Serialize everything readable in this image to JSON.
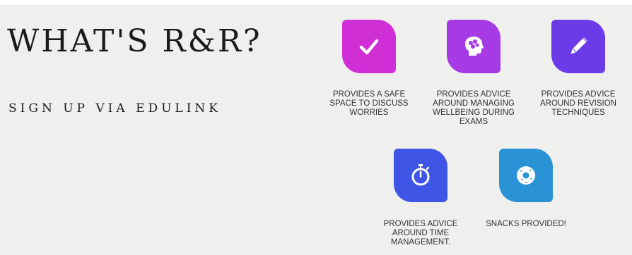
{
  "title": "WHAT'S R&R?",
  "subtitle": "SIGN UP VIA EDULINK",
  "features": [
    {
      "icon": "checkmark-icon",
      "color": "#d12fd6",
      "caption": "PROVIDES A SAFE SPACE TO DISCUSS WORRIES"
    },
    {
      "icon": "brain-icon",
      "color": "#a63be6",
      "caption": "PROVIDES ADVICE AROUND MANAGING WELLBEING DURING EXAMS"
    },
    {
      "icon": "pencil-icon",
      "color": "#6a3be6",
      "caption": "PROVIDES ADVICE AROUND REVISION TECHNIQUES"
    },
    {
      "icon": "stopwatch-icon",
      "color": "#3f55e6",
      "caption": "PROVIDES ADVICE AROUND TIME MANAGEMENT."
    },
    {
      "icon": "donut-icon",
      "color": "#2a93d6",
      "caption": "SNACKS PROVIDED!"
    }
  ]
}
